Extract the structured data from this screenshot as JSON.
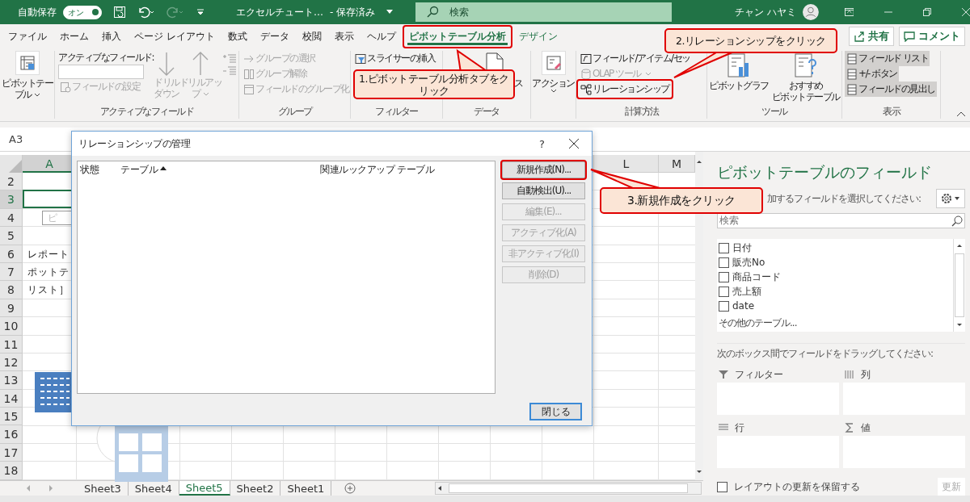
{
  "title_bar": {
    "autosave_label": "自動保存",
    "autosave_toggle": {
      "label": "オン",
      "on": true
    },
    "file_name": "エクセルチュート…",
    "save_status": "- 保存済み",
    "search": {
      "placeholder": "検索"
    },
    "user_name": "チャン ハヤミ"
  },
  "tabs": [
    {
      "label": "ファイル",
      "selected": false,
      "contextual": false
    },
    {
      "label": "ホーム",
      "selected": false,
      "contextual": false
    },
    {
      "label": "挿入",
      "selected": false,
      "contextual": false
    },
    {
      "label": "ページ レイアウト",
      "selected": false,
      "contextual": false
    },
    {
      "label": "数式",
      "selected": false,
      "contextual": false
    },
    {
      "label": "データ",
      "selected": false,
      "contextual": false
    },
    {
      "label": "校閲",
      "selected": false,
      "contextual": false
    },
    {
      "label": "表示",
      "selected": false,
      "contextual": false
    },
    {
      "label": "ヘルプ",
      "selected": false,
      "contextual": false
    },
    {
      "label": "ピボットテーブル分析",
      "selected": true,
      "contextual": true
    },
    {
      "label": "デザイン",
      "selected": false,
      "contextual": true
    }
  ],
  "share_button": "共有",
  "comment_button": "コメント",
  "ribbon": {
    "pivot_table": {
      "lines": [
        "ピボットテー",
        "ブル"
      ]
    },
    "active_field": {
      "label": "アクティブなフィールド:",
      "field_settings": {
        "label": "フィールドの設定",
        "disabled": true
      },
      "drill_down": {
        "lines": [
          "ドリル",
          "ダウン"
        ],
        "disabled": true
      },
      "drill_up": {
        "lines": [
          "ドリルアッ",
          "プ"
        ],
        "disabled": true
      },
      "group_label": "アクティブなフィールド"
    },
    "group": {
      "items": [
        {
          "label": "グループの選択",
          "disabled": true
        },
        {
          "label": "グループ解除",
          "disabled": true
        },
        {
          "label": "フィールドのグループ化",
          "disabled": true
        }
      ],
      "group_label": "グループ"
    },
    "filter": {
      "items": [
        {
          "label": "スライサーの挿入",
          "disabled": false
        }
      ],
      "group_label": "フィルター"
    },
    "data": {
      "fragment": "ス",
      "group_label": "データ"
    },
    "action": {
      "label": "アクション"
    },
    "calculations": {
      "items": [
        {
          "label": "フィールド/アイテム/セッ",
          "disabled": false
        },
        {
          "label": "OLAP ツール",
          "disabled": true
        },
        {
          "label": "リレーションシップ",
          "disabled": false
        }
      ],
      "group_label": "計算方法"
    },
    "tools": {
      "items": [
        {
          "lines": [
            "ピボットグラフ"
          ]
        },
        {
          "lines": [
            "おすすめ",
            "ピボットテーブル"
          ]
        }
      ],
      "group_label": "ツール"
    },
    "show": {
      "items": [
        {
          "label": "フィールド リスト",
          "on": true
        },
        {
          "label": "+/- ボタン",
          "on": true
        },
        {
          "label": "フィールドの見出し",
          "on": true
        }
      ],
      "group_label": "表示"
    }
  },
  "formula_bar": {
    "name_box": "A3"
  },
  "sheet": {
    "columns": [
      {
        "label": "A",
        "selected": true
      },
      {
        "label": "L",
        "selected": false
      },
      {
        "label": "M",
        "selected": false
      }
    ],
    "rows": [
      {
        "label": "2",
        "selected": false
      },
      {
        "label": "3",
        "selected": true
      },
      {
        "label": "4",
        "selected": false,
        "cell": {
          "kind": "button",
          "text": "ピ"
        }
      },
      {
        "label": "5",
        "selected": false
      },
      {
        "label": "6",
        "selected": false,
        "cell": {
          "kind": "text",
          "text": "レポート"
        }
      },
      {
        "label": "7",
        "selected": false,
        "cell": {
          "kind": "text",
          "text": "ポットテ"
        }
      },
      {
        "label": "8",
        "selected": false,
        "cell": {
          "kind": "text",
          "text": "リスト］"
        }
      },
      {
        "label": "9",
        "selected": false
      },
      {
        "label": "10",
        "selected": false
      },
      {
        "label": "11",
        "selected": false
      },
      {
        "label": "12",
        "selected": false
      },
      {
        "label": "13",
        "selected": false
      },
      {
        "label": "14",
        "selected": false
      },
      {
        "label": "15",
        "selected": false
      },
      {
        "label": "16",
        "selected": false
      },
      {
        "label": "17",
        "selected": false
      },
      {
        "label": "18",
        "selected": false
      }
    ]
  },
  "dialog": {
    "title": "リレーションシップの管理",
    "help": "?",
    "columns": [
      "状態",
      "テーブル",
      "関連ルックアップ テーブル"
    ],
    "buttons": [
      {
        "label": "新規作成(N)...",
        "disabled": false
      },
      {
        "label": "自動検出(U)...",
        "disabled": false
      },
      {
        "label": "編集(E)...",
        "disabled": true
      },
      {
        "label": "アクティブ化(A)",
        "disabled": true
      },
      {
        "label": "非アクティブ化(I)",
        "disabled": true
      },
      {
        "label": "削除(D)",
        "disabled": true
      }
    ],
    "close_button": "閉じる"
  },
  "field_pane": {
    "title": "ピボットテーブルのフィールド",
    "instruction": "加するフィールドを選択してください:",
    "search": {
      "placeholder": "検索"
    },
    "fields": [
      {
        "label": "日付",
        "checked": false
      },
      {
        "label": "販売No",
        "checked": false
      },
      {
        "label": "商品コード",
        "checked": false
      },
      {
        "label": "売上額",
        "checked": false
      },
      {
        "label": "date",
        "checked": false
      }
    ],
    "more_tables": "その他のテーブル...",
    "drag_instruction": "次のボックス間でフィールドをドラッグしてください:",
    "areas": [
      {
        "kind": "filter",
        "label": "フィルター"
      },
      {
        "kind": "columns",
        "label": "列"
      },
      {
        "kind": "rows",
        "label": "行"
      },
      {
        "kind": "values",
        "label": "値"
      }
    ],
    "defer_update": {
      "label": "レイアウトの更新を保留する",
      "checked": false
    },
    "update_button": {
      "label": "更新",
      "disabled": true
    }
  },
  "sheet_tabs": [
    {
      "label": "Sheet3",
      "selected": false
    },
    {
      "label": "Sheet4",
      "selected": false
    },
    {
      "label": "Sheet5",
      "selected": true
    },
    {
      "label": "Sheet2",
      "selected": false
    },
    {
      "label": "Sheet1",
      "selected": false
    }
  ],
  "annotations": [
    {
      "text": "1.ピボットテーブル分析タブをクリック"
    },
    {
      "text": "2.リレーションシップをクリック"
    },
    {
      "text": "3.新規作成をクリック"
    }
  ]
}
